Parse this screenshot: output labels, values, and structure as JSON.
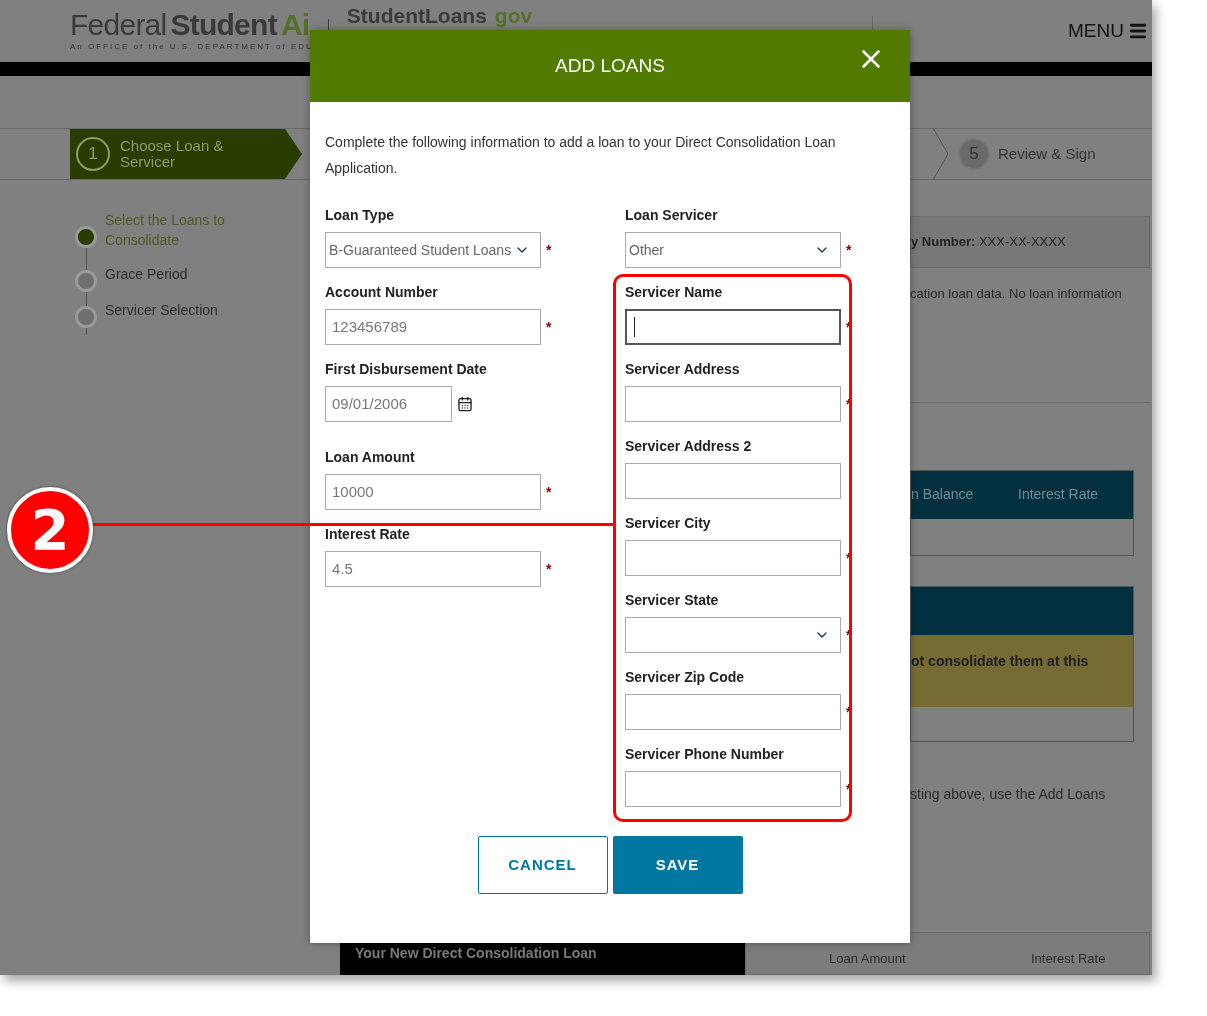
{
  "header": {
    "brand": [
      "Federal",
      "Student",
      "Ai"
    ],
    "tagline": "An OFFICE of the U.S. DEPARTMENT of EDU",
    "site": [
      "StudentLoans",
      "gov"
    ],
    "menu": "MENU"
  },
  "steps": [
    {
      "number": "1",
      "label": "Choose Loan & Servicer",
      "selected": true
    },
    {
      "number": "5",
      "label": "Review & Sign",
      "selected": false
    }
  ],
  "substeps": [
    {
      "label": "Select the Loans to Consolidate",
      "selected": true
    },
    {
      "label": "Grace Period",
      "selected": false
    },
    {
      "label": "Servicer Selection",
      "selected": false
    }
  ],
  "background": {
    "id_line": "**y Number:** XXX-XX-XXXX",
    "notice": "cation loan data. No loan information",
    "table_columns": [
      "n Balance",
      "Interest Rate"
    ],
    "alert": "ot consolidate them at this",
    "hint": "sting above, use the Add Loans",
    "new_loan_title": "Your New Direct Consolidation Loan",
    "summary": [
      "Loan Amount",
      "Interest Rate"
    ]
  },
  "dialog": {
    "title": "ADD LOANS",
    "description": "Complete the following information to add a loan to your Direct Consolidation Loan Application.",
    "required_mark": "*",
    "left_fields": [
      {
        "label": "Loan Type",
        "kind": "select",
        "value": "B-Guaranteed Student Loans",
        "required": true,
        "focused": false
      },
      {
        "label": "Account Number",
        "kind": "text",
        "value": "123456789",
        "required": true,
        "focused": false
      },
      {
        "label": "First Disbursement Date",
        "kind": "date",
        "value": "09/01/2006",
        "required": false,
        "focused": false
      },
      {
        "label": "Loan Amount",
        "kind": "text",
        "value": "10000",
        "required": true,
        "focused": false
      },
      {
        "label": "Interest Rate",
        "kind": "text",
        "value": "4.5",
        "required": true,
        "focused": false
      }
    ],
    "right_fields": [
      {
        "label": "Loan Servicer",
        "kind": "select",
        "value": "Other",
        "required": true,
        "focused": false
      },
      {
        "label": "Servicer Name",
        "kind": "text",
        "required": true,
        "focused": true
      },
      {
        "label": "Servicer Address",
        "kind": "text",
        "required": true,
        "focused": false
      },
      {
        "label": "Servicer Address 2",
        "kind": "text",
        "required": false,
        "focused": false
      },
      {
        "label": "Servicer City",
        "kind": "text",
        "required": true,
        "focused": false
      },
      {
        "label": "Servicer State",
        "kind": "select",
        "required": true,
        "focused": false
      },
      {
        "label": "Servicer Zip Code",
        "kind": "text",
        "required": true,
        "focused": false
      },
      {
        "label": "Servicer Phone Number",
        "kind": "text",
        "required": true,
        "focused": false
      }
    ],
    "buttons": [
      {
        "label": "CANCEL",
        "kind": "secondary"
      },
      {
        "label": "SAVE",
        "kind": "primary"
      }
    ]
  },
  "annotation": {
    "number": "2"
  }
}
